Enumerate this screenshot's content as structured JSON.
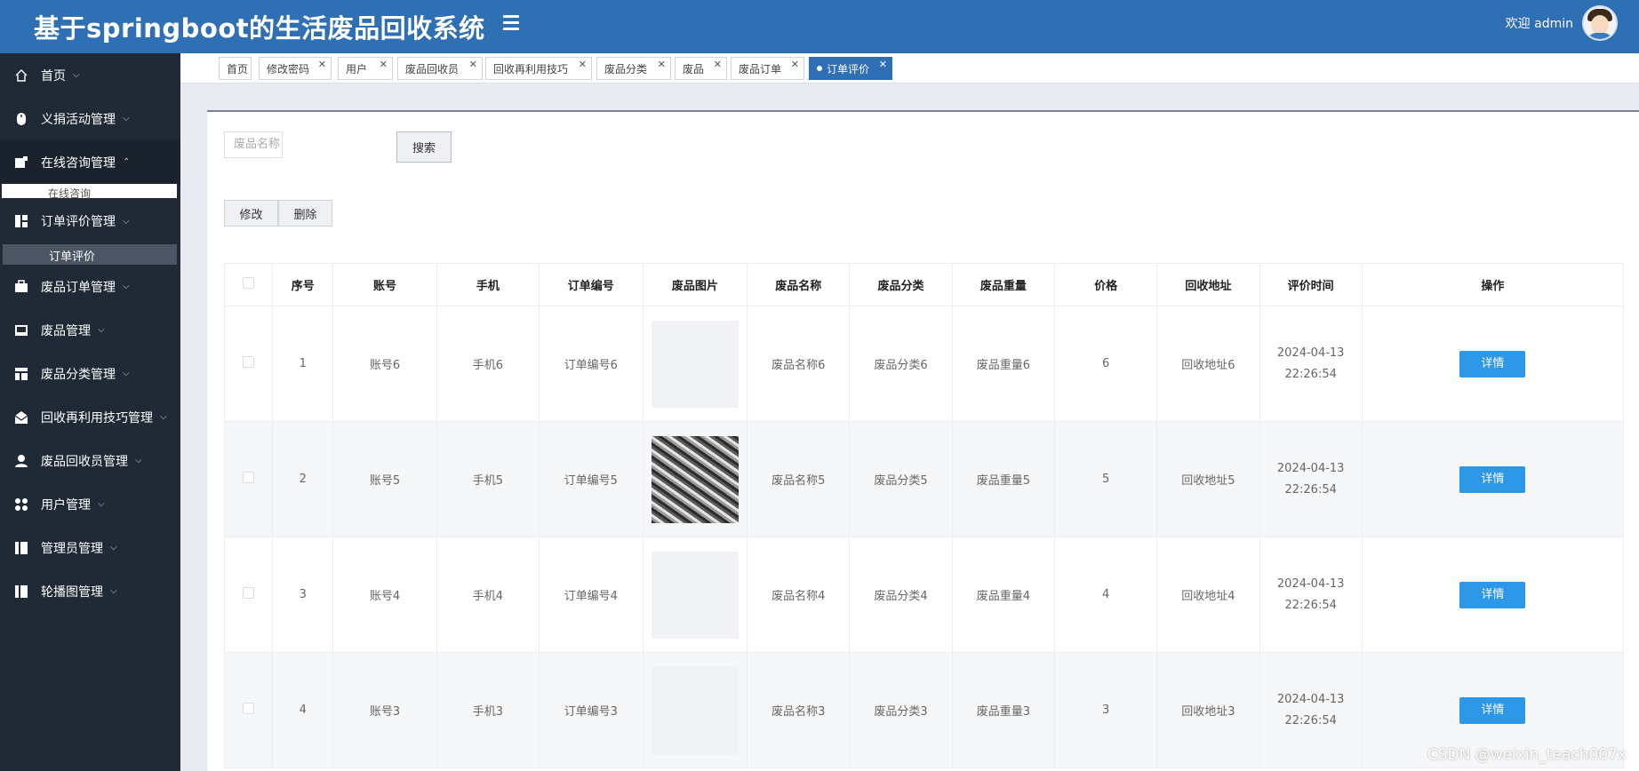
{
  "header": {
    "title": "基于springboot的生活废品回收系统",
    "welcome": "欢迎 admin"
  },
  "sidebar": {
    "items": [
      {
        "label": "首页",
        "icon": "home-icon"
      },
      {
        "label": "义捐活动管理",
        "icon": "mouse-icon"
      },
      {
        "label": "在线咨询管理",
        "icon": "chat-icon"
      },
      {
        "label": "订单评价管理",
        "icon": "grid-icon"
      },
      {
        "label": "废品订单管理",
        "icon": "briefcase-icon"
      },
      {
        "label": "废品管理",
        "icon": "picture-icon"
      },
      {
        "label": "废品分类管理",
        "icon": "layout-icon"
      },
      {
        "label": "回收再利用技巧管理",
        "icon": "mail-icon"
      },
      {
        "label": "废品回收员管理",
        "icon": "person-icon"
      },
      {
        "label": "用户管理",
        "icon": "dots-icon"
      },
      {
        "label": "管理员管理",
        "icon": "book-icon"
      },
      {
        "label": "轮播图管理",
        "icon": "book-icon"
      }
    ],
    "sub_online": "在线咨询",
    "sub_active": "订单评价"
  },
  "tabs": [
    {
      "label": "首页"
    },
    {
      "label": "修改密码"
    },
    {
      "label": "用户"
    },
    {
      "label": "废品回收员"
    },
    {
      "label": "回收再利用技巧"
    },
    {
      "label": "废品分类"
    },
    {
      "label": "废品"
    },
    {
      "label": "废品订单"
    },
    {
      "label": "订单评价"
    }
  ],
  "toolbar": {
    "search_placeholder": "废品名称",
    "search_label": "搜索",
    "edit_label": "修改",
    "delete_label": "删除"
  },
  "table": {
    "headers": [
      "序号",
      "账号",
      "手机",
      "订单编号",
      "废品图片",
      "废品名称",
      "废品分类",
      "废品重量",
      "价格",
      "回收地址",
      "评价时间",
      "操作"
    ],
    "rows": [
      {
        "no": "1",
        "account": "账号6",
        "phone": "手机6",
        "order": "订单编号6",
        "name": "废品名称6",
        "category": "废品分类6",
        "weight": "废品重量6",
        "price": "6",
        "address": "回收地址6",
        "time": "2024-04-13 22:26:54",
        "action": "详情"
      },
      {
        "no": "2",
        "account": "账号5",
        "phone": "手机5",
        "order": "订单编号5",
        "name": "废品名称5",
        "category": "废品分类5",
        "weight": "废品重量5",
        "price": "5",
        "address": "回收地址5",
        "time": "2024-04-13 22:26:54",
        "action": "详情"
      },
      {
        "no": "3",
        "account": "账号4",
        "phone": "手机4",
        "order": "订单编号4",
        "name": "废品名称4",
        "category": "废品分类4",
        "weight": "废品重量4",
        "price": "4",
        "address": "回收地址4",
        "time": "2024-04-13 22:26:54",
        "action": "详情"
      },
      {
        "no": "4",
        "account": "账号3",
        "phone": "手机3",
        "order": "订单编号3",
        "name": "废品名称3",
        "category": "废品分类3",
        "weight": "废品重量3",
        "price": "3",
        "address": "回收地址3",
        "time": "2024-04-13 22:26:54",
        "action": "详情"
      }
    ]
  },
  "watermark": "CSDN @weixin_teach007x",
  "colors": {
    "header": "#2f6fb3",
    "sidebar": "#1f2a36",
    "detail_button": "#2d97e8"
  }
}
